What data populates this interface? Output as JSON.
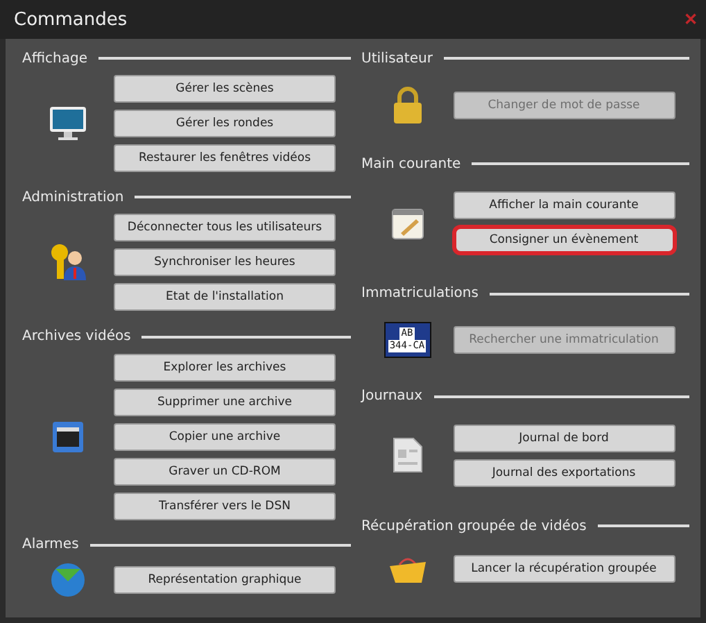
{
  "window": {
    "title": "Commandes",
    "close": "✕"
  },
  "columns": [
    [
      {
        "title": "Affichage",
        "buttons": [
          {
            "label": "Gérer les scènes",
            "disabled": false,
            "highlighted": false
          },
          {
            "label": "Gérer les rondes",
            "disabled": false,
            "highlighted": false
          },
          {
            "label": "Restaurer les fenêtres vidéos",
            "disabled": false,
            "highlighted": false
          }
        ]
      },
      {
        "title": "Administration",
        "buttons": [
          {
            "label": "Déconnecter tous les utilisateurs",
            "disabled": false,
            "highlighted": false
          },
          {
            "label": "Synchroniser les heures",
            "disabled": false,
            "highlighted": false
          },
          {
            "label": "Etat de l'installation",
            "disabled": false,
            "highlighted": false
          }
        ]
      },
      {
        "title": "Archives vidéos",
        "buttons": [
          {
            "label": "Explorer les archives",
            "disabled": false,
            "highlighted": false
          },
          {
            "label": "Supprimer une archive",
            "disabled": false,
            "highlighted": false
          },
          {
            "label": "Copier une archive",
            "disabled": false,
            "highlighted": false
          },
          {
            "label": "Graver un CD-ROM",
            "disabled": false,
            "highlighted": false
          },
          {
            "label": "Transférer vers le DSN",
            "disabled": false,
            "highlighted": false
          }
        ]
      },
      {
        "title": "Alarmes",
        "buttons": [
          {
            "label": "Représentation graphique",
            "disabled": false,
            "highlighted": false
          }
        ]
      }
    ],
    [
      {
        "title": "Utilisateur",
        "buttons": [
          {
            "label": "Changer de mot de passe",
            "disabled": true,
            "highlighted": false
          }
        ]
      },
      {
        "title": "Main courante",
        "buttons": [
          {
            "label": "Afficher la main courante",
            "disabled": false,
            "highlighted": false
          },
          {
            "label": "Consigner un évènement",
            "disabled": false,
            "highlighted": true
          }
        ]
      },
      {
        "title": "Immatriculations",
        "plate_text": [
          "AB",
          "344-CA"
        ],
        "buttons": [
          {
            "label": "Rechercher une immatriculation",
            "disabled": true,
            "highlighted": false
          }
        ]
      },
      {
        "title": "Journaux",
        "buttons": [
          {
            "label": "Journal de bord",
            "disabled": false,
            "highlighted": false
          },
          {
            "label": "Journal des exportations",
            "disabled": false,
            "highlighted": false
          }
        ]
      },
      {
        "title": "Récupération groupée de vidéos",
        "buttons": [
          {
            "label": "Lancer la récupération groupée",
            "disabled": false,
            "highlighted": false
          }
        ]
      }
    ]
  ]
}
